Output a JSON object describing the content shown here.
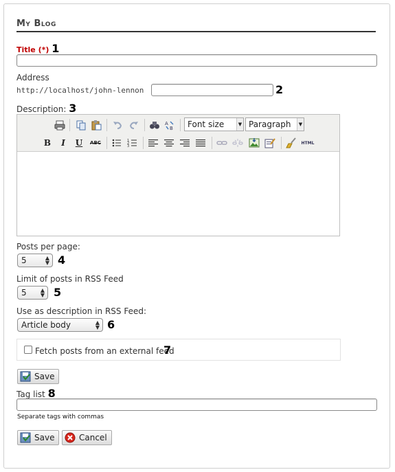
{
  "page": {
    "title": "My Blog"
  },
  "form": {
    "title": {
      "label": "Title",
      "required_marker": "(*)",
      "number": "1",
      "value": ""
    },
    "address": {
      "label": "Address",
      "prefix": "http://localhost/john-lennon",
      "number": "2",
      "value": ""
    },
    "description": {
      "label": "Description:",
      "number": "3"
    },
    "posts_per_page": {
      "label": "Posts per page:",
      "value": "5",
      "number": "4"
    },
    "rss_limit": {
      "label": "Limit of posts in RSS Feed",
      "value": "5",
      "number": "5"
    },
    "rss_description": {
      "label": "Use as description in RSS Feed:",
      "value": "Article body",
      "number": "6"
    },
    "external_feed": {
      "label": "Fetch posts from an external feed",
      "checked": false,
      "number": "7"
    },
    "tag_list": {
      "label": "Tag list",
      "number": "8",
      "value": "",
      "hint": "Separate tags with commas"
    }
  },
  "editor": {
    "toolbar_row1": [
      "print-icon",
      "copy-icon",
      "paste-icon",
      "undo-icon",
      "redo-icon",
      "find-icon",
      "replace-icon"
    ],
    "font_size": "Font size",
    "format": "Paragraph",
    "toolbar_row2": {
      "bold": "B",
      "italic": "I",
      "underline": "U",
      "strike": "ABC",
      "html": "HTML"
    }
  },
  "buttons": {
    "save": "Save",
    "cancel": "Cancel"
  },
  "colors": {
    "required": "#c00000",
    "heading_rule": "#333333"
  }
}
